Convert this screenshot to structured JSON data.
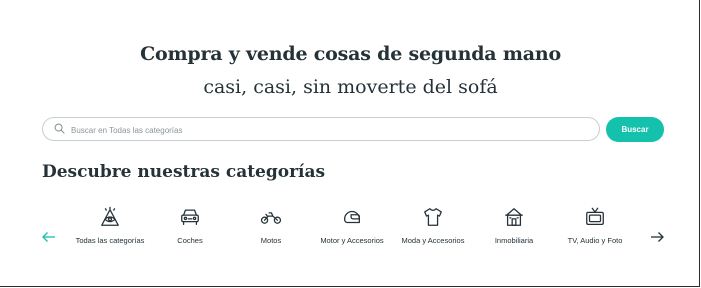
{
  "hero": {
    "title": "Compra y vende cosas de segunda mano",
    "subtitle": "casi, casi, sin moverte del sofá"
  },
  "search": {
    "placeholder": "Buscar en Todas las categorías",
    "value": "",
    "button_label": "Buscar",
    "button_color": "#13c1ac"
  },
  "categories_section": {
    "title": "Descubre nuestras categorías",
    "items": [
      {
        "label": "Todas las categorías",
        "icon": "all-categories-icon"
      },
      {
        "label": "Coches",
        "icon": "car-icon"
      },
      {
        "label": "Motos",
        "icon": "motorbike-icon"
      },
      {
        "label": "Motor y Accesorios",
        "icon": "helmet-icon"
      },
      {
        "label": "Moda y Accesorios",
        "icon": "tshirt-icon"
      },
      {
        "label": "Inmobiliaria",
        "icon": "house-icon"
      },
      {
        "label": "TV, Audio y Foto",
        "icon": "tv-icon"
      }
    ]
  }
}
